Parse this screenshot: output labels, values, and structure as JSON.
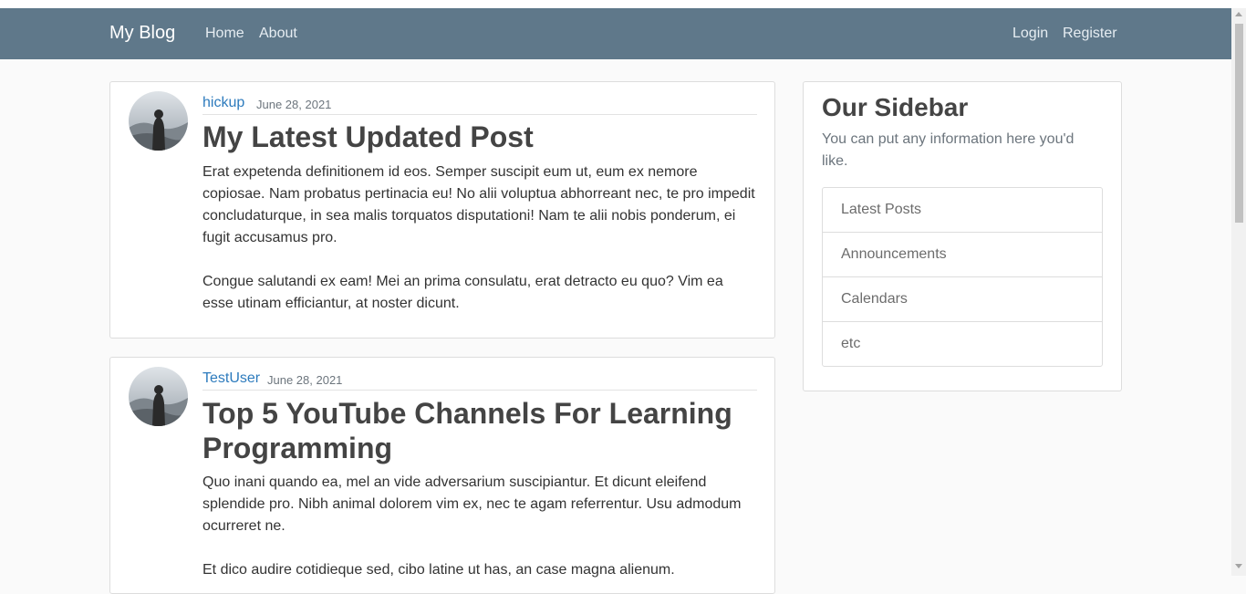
{
  "navbar": {
    "brand": "My Blog",
    "links": [
      "Home",
      "About"
    ],
    "auth": [
      "Login",
      "Register"
    ]
  },
  "posts": [
    {
      "author": "hickup",
      "date": "June 28, 2021",
      "title": "My Latest Updated Post",
      "content": "Erat expetenda definitionem id eos. Semper suscipit eum ut, eum ex nemore copiosae. Nam probatus pertinacia eu! No alii voluptua abhorreant nec, te pro impedit concludaturque, in sea malis torquatos disputationi! Nam te alii nobis ponderum, ei fugit accusamus pro.\n\nCongue salutandi ex eam! Mei an prima consulatu, erat detracto eu quo? Vim ea esse utinam efficiantur, at noster dicunt."
    },
    {
      "author": "TestUser",
      "date": "June 28, 2021",
      "title": "Top 5 YouTube Channels For Learning Programming",
      "content": "Quo inani quando ea, mel an vide adversarium suscipiantur. Et dicunt eleifend splendide pro. Nibh animal dolorem vim ex, nec te agam referrentur. Usu admodum ocurreret ne.\n\nEt dico audire cotidieque sed, cibo latine ut has, an case magna alienum."
    }
  ],
  "sidebar": {
    "title": "Our Sidebar",
    "description": "You can put any information here you'd like.",
    "items": [
      "Latest Posts",
      "Announcements",
      "Calendars",
      "etc"
    ]
  }
}
